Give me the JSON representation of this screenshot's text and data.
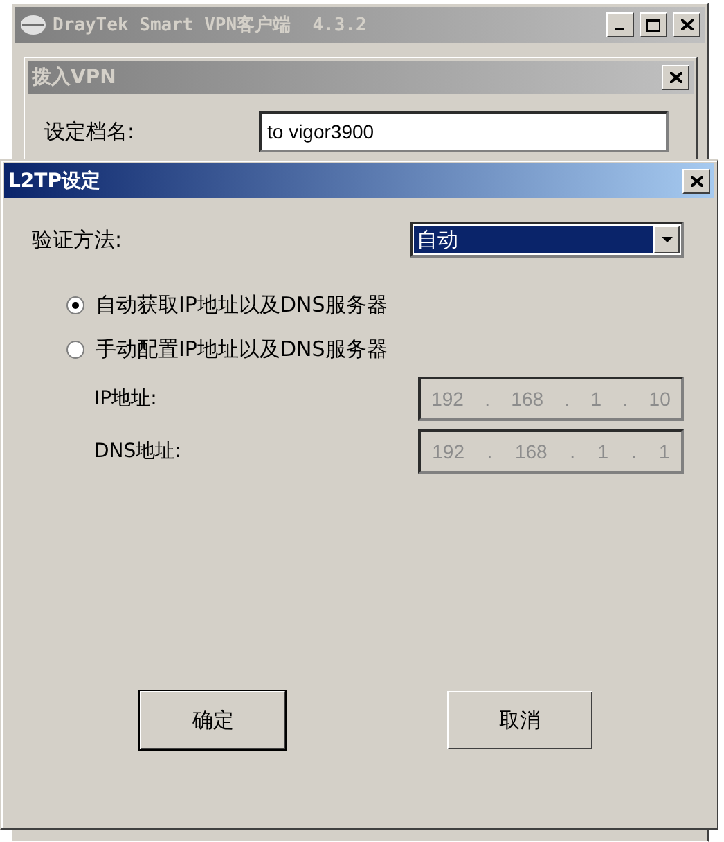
{
  "main_window": {
    "title": "DrayTek Smart VPN客户端  4.3.2"
  },
  "dial_in_dialog": {
    "title": "拨入VPN",
    "profile": {
      "label": "设定档名:",
      "value": "to vigor3900"
    }
  },
  "l2tp_dialog": {
    "title": "L2TP设定",
    "auth_method": {
      "label": "验证方法:",
      "value": "自动"
    },
    "options": [
      {
        "label": "自动获取IP地址以及DNS服务器",
        "selected": true
      },
      {
        "label": "手动配置IP地址以及DNS服务器",
        "selected": false
      }
    ],
    "address_fields": [
      {
        "label": "IP地址:",
        "octets": [
          "192",
          "168",
          "1",
          "10"
        ],
        "disabled": true
      },
      {
        "label": "DNS地址:",
        "octets": [
          "192",
          "168",
          "1",
          "1"
        ],
        "disabled": true
      }
    ],
    "separator": ".",
    "buttons": [
      {
        "label": "确定",
        "default": true
      },
      {
        "label": "取消",
        "default": false
      }
    ]
  }
}
